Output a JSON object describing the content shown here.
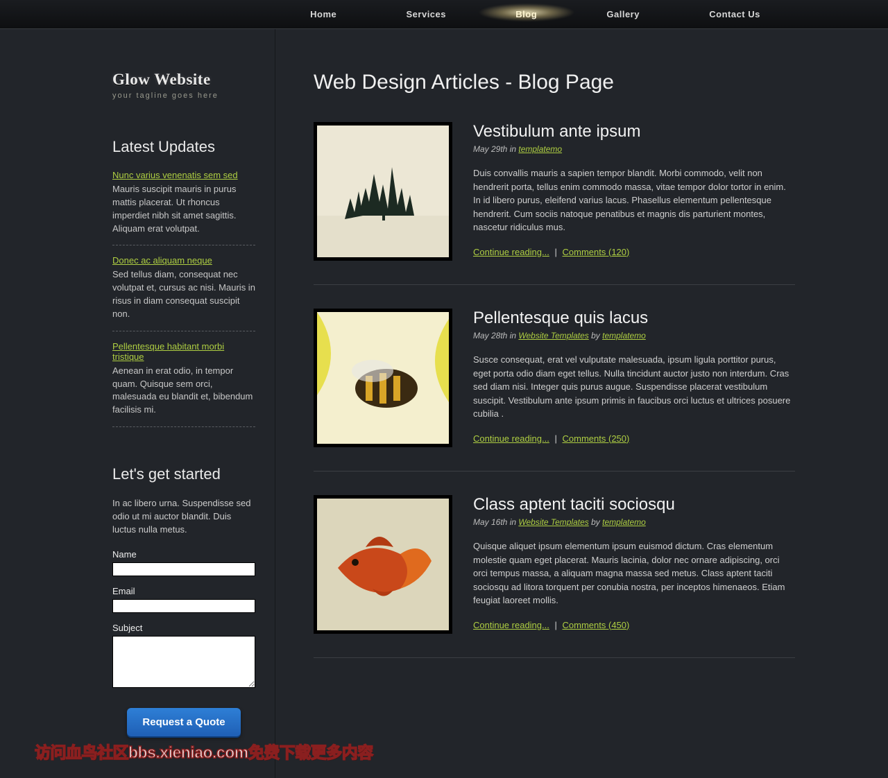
{
  "nav": {
    "items": [
      {
        "label": "Home"
      },
      {
        "label": "Services"
      },
      {
        "label": "Blog"
      },
      {
        "label": "Gallery"
      },
      {
        "label": "Contact Us"
      }
    ],
    "active_index": 2
  },
  "brand": {
    "name": "Glow Website",
    "tagline": "your tagline goes here"
  },
  "sidebar": {
    "updates_heading": "Latest Updates",
    "updates": [
      {
        "title": "Nunc varius venenatis sem sed",
        "text": "Mauris suscipit mauris in purus mattis placerat. Ut rhoncus imperdiet nibh sit amet sagittis. Aliquam erat volutpat."
      },
      {
        "title": "Donec ac aliquam neque",
        "text": "Sed tellus diam, consequat nec volutpat et, cursus ac nisi. Mauris in risus in diam consequat suscipit non."
      },
      {
        "title": "Pellentesque habitant morbi tristique",
        "text": "Aenean in erat odio, in tempor quam. Quisque sem orci, malesuada eu blandit et, bibendum facilisis mi."
      }
    ],
    "form_heading": "Let's get started",
    "form_intro": "In ac libero urna. Suspendisse sed odio ut mi auctor blandit. Duis luctus nulla metus.",
    "labels": {
      "name": "Name",
      "email": "Email",
      "subject": "Subject"
    },
    "button": "Request a Quote"
  },
  "main": {
    "title": "Web Design Articles - Blog Page",
    "continue_label": "Continue reading...",
    "comments_prefix": "Comments",
    "sep": "|",
    "posts": [
      {
        "title": "Vestibulum ante ipsum",
        "meta_prefix": "May 29th in ",
        "cat": "templatemo",
        "by": "",
        "author": "",
        "text": "Duis convallis mauris a sapien tempor blandit. Morbi commodo, velit non hendrerit porta, tellus enim commodo massa, vitae tempor dolor tortor in enim. In id libero purus, eleifend varius lacus. Phasellus elementum pellentesque hendrerit. Cum sociis natoque penatibus et magnis dis parturient montes, nascetur ridiculus mus.",
        "comments": 120
      },
      {
        "title": "Pellentesque quis lacus",
        "meta_prefix": "May 28th in ",
        "cat": "Website Templates",
        "by": " by ",
        "author": "templatemo",
        "text": "Susce consequat, erat vel vulputate malesuada, ipsum ligula porttitor purus, eget porta odio diam eget tellus. Nulla tincidunt auctor justo non interdum. Cras sed diam nisi. Integer quis purus augue. Suspendisse placerat vestibulum suscipit. Vestibulum ante ipsum primis in faucibus orci luctus et ultrices posuere cubilia .",
        "comments": 250
      },
      {
        "title": "Class aptent taciti sociosqu",
        "meta_prefix": "May 16th in ",
        "cat": "Website Templates",
        "by": " by ",
        "author": "templatemo",
        "text": "Quisque aliquet ipsum elementum ipsum euismod dictum. Cras elementum molestie quam eget placerat. Mauris lacinia, dolor nec ornare adipiscing, orci orci tempus massa, a aliquam magna massa sed metus. Class aptent taciti sociosqu ad litora torquent per conubia nostra, per inceptos himenaeos. Etiam feugiat laoreet mollis.",
        "comments": 450
      }
    ]
  },
  "watermark": "访问血鸟社区bbs.xieniao.com免费下载更多内容"
}
